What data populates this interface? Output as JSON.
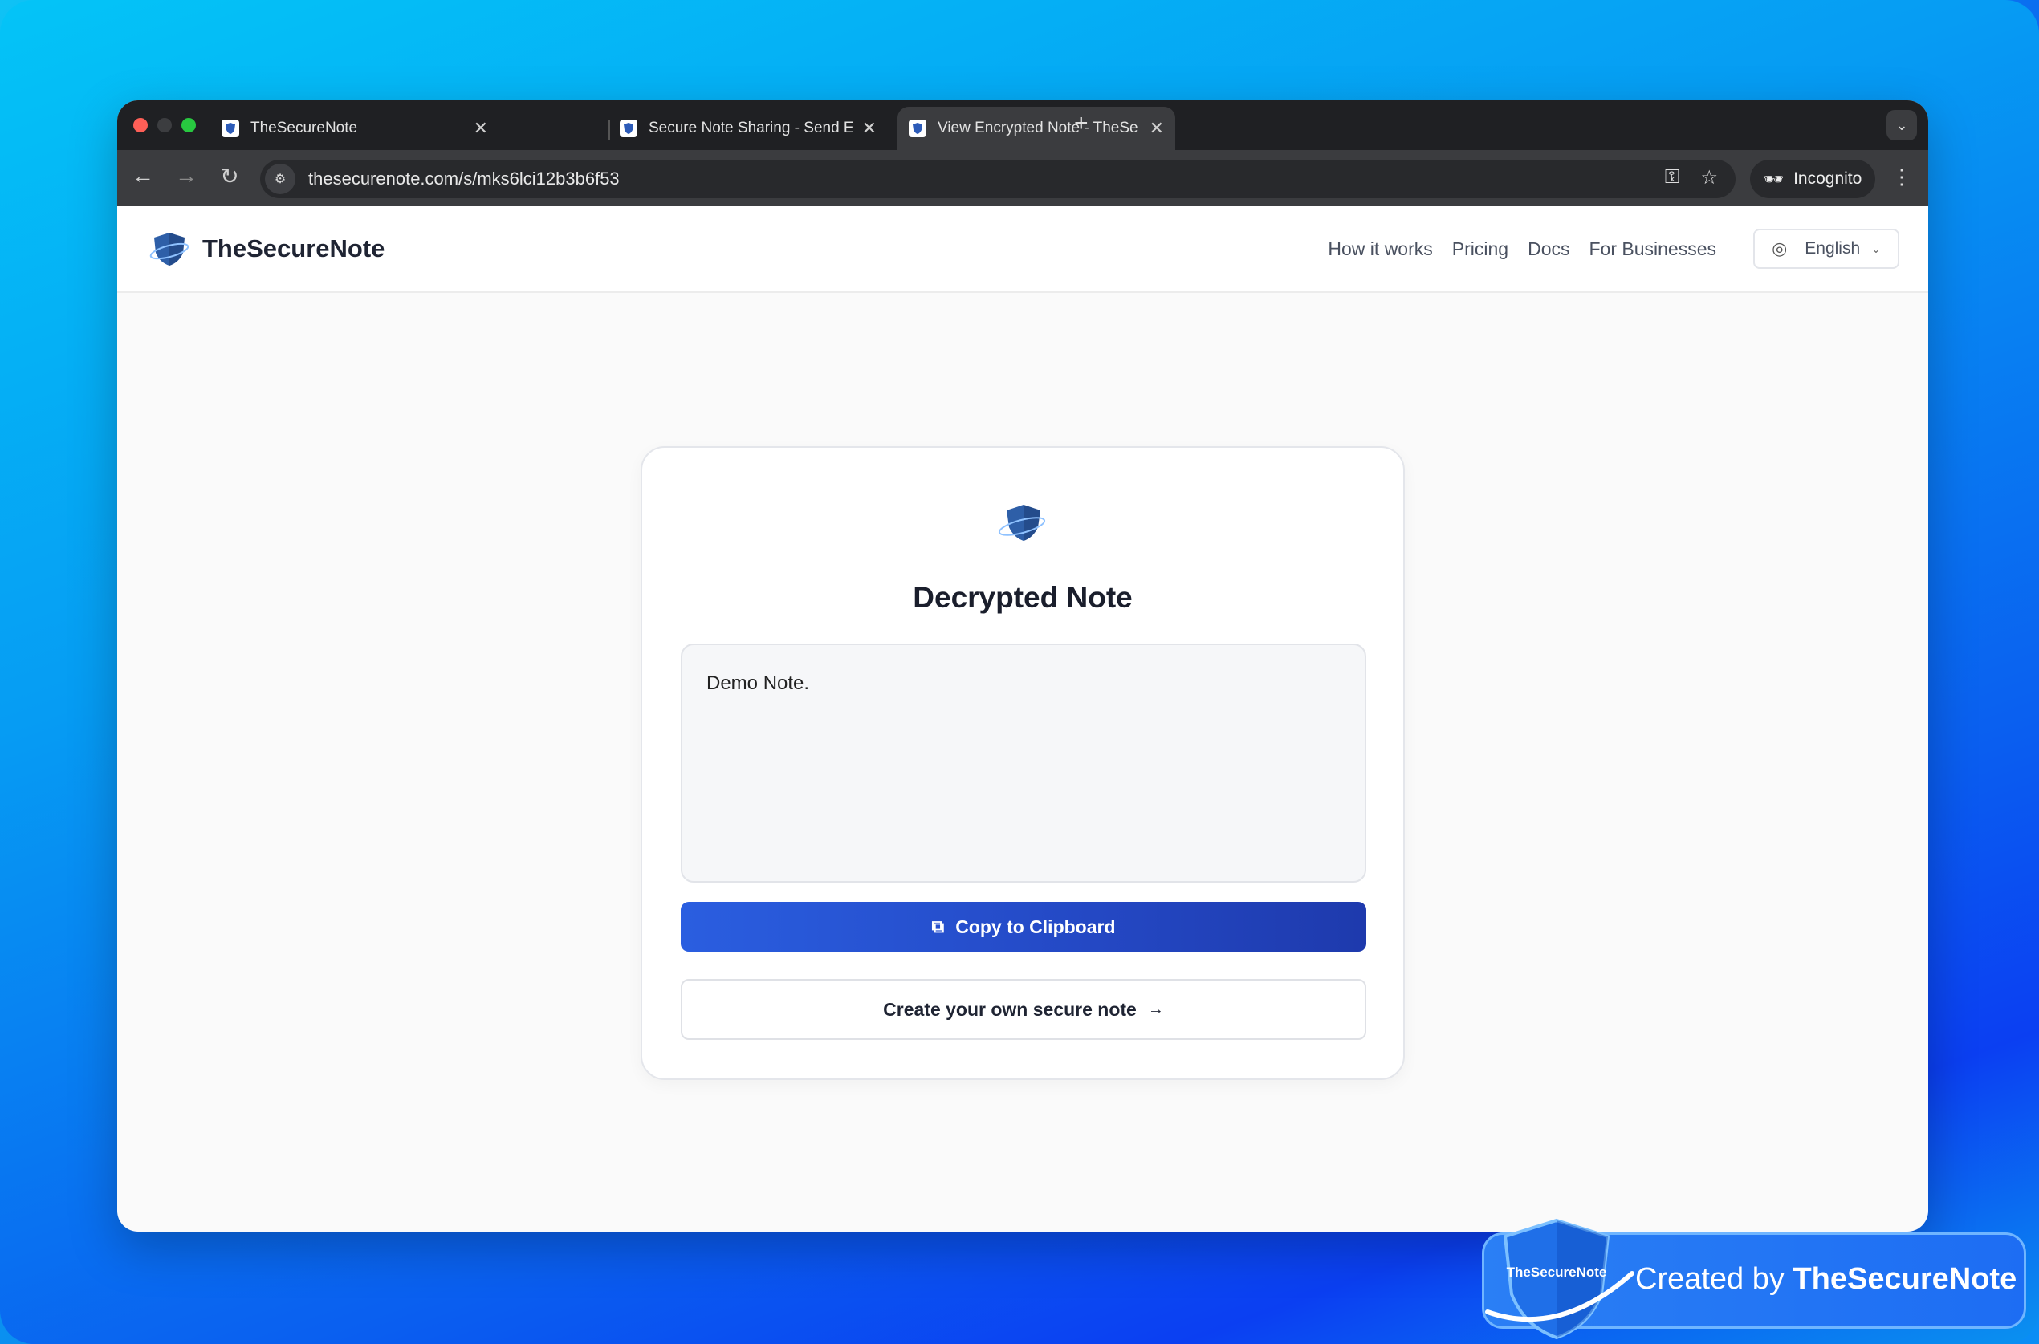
{
  "browser": {
    "tabs": [
      {
        "title": "TheSecureNote",
        "active": false
      },
      {
        "title": "Secure Note Sharing - Send E",
        "active": false
      },
      {
        "title": "View Encrypted Note - TheSe",
        "active": true
      }
    ],
    "url": "thesecurenote.com/s/mks6lci12b3b6f53",
    "incognito_label": "Incognito"
  },
  "header": {
    "brand": "TheSecureNote",
    "nav": [
      "How it works",
      "Pricing",
      "Docs",
      "For Businesses"
    ],
    "language": "English"
  },
  "card": {
    "title": "Decrypted Note",
    "note_text": "Demo Note.",
    "copy_label": "Copy to Clipboard",
    "create_label": "Create your own secure note"
  },
  "badge": {
    "shield_text": "TheSecureNote",
    "created_by": "Created by",
    "brand": "TheSecureNote"
  },
  "colors": {
    "accent": "#2448c4",
    "brand_blue": "#1d6df3"
  }
}
